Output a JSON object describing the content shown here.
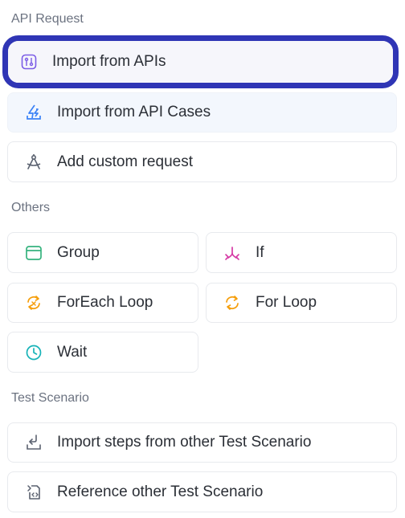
{
  "sections": {
    "api_request": "API Request",
    "others": "Others",
    "test_scenario": "Test Scenario"
  },
  "api_items": [
    {
      "label": "Import from APIs",
      "icon": "api-import-icon",
      "selected": true
    },
    {
      "label": "Import from API Cases",
      "icon": "lightning-import-icon"
    },
    {
      "label": "Add custom request",
      "icon": "compass-icon"
    }
  ],
  "other_items": [
    {
      "label": "Group",
      "icon": "group-box-icon"
    },
    {
      "label": "If",
      "icon": "branch-icon"
    },
    {
      "label": "ForEach Loop",
      "icon": "foreach-loop-icon"
    },
    {
      "label": "For Loop",
      "icon": "loop-icon"
    },
    {
      "label": "Wait",
      "icon": "clock-icon"
    }
  ],
  "scenario_items": [
    {
      "label": "Import steps from other Test Scenario",
      "icon": "import-steps-icon"
    },
    {
      "label": "Reference other Test Scenario",
      "icon": "reference-doc-icon"
    }
  ],
  "colors": {
    "selection_border": "#2f35b5",
    "purple": "#7b5ce6",
    "blue": "#3b82f6",
    "green": "#36b37e",
    "pink": "#d63aa5",
    "orange": "#f59e0b",
    "teal": "#17b3b8",
    "gray_icon": "#5b6270"
  }
}
